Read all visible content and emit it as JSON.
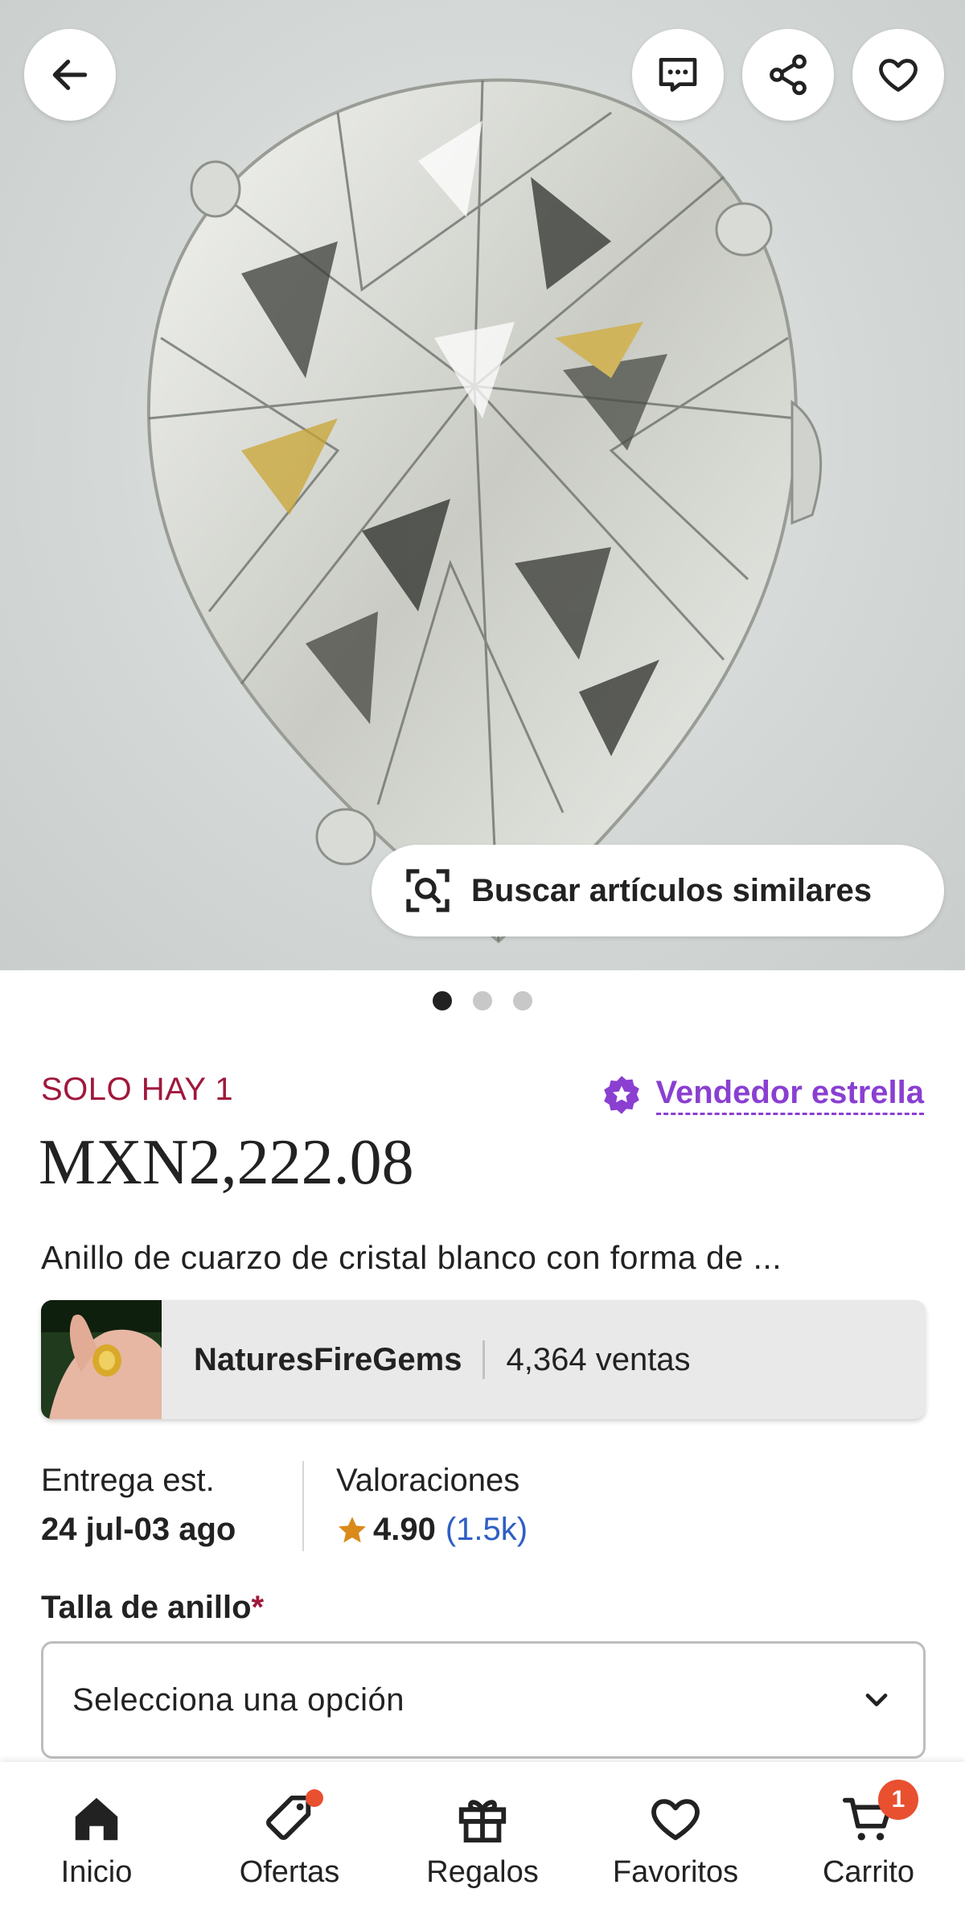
{
  "hero": {
    "similar_button_label": "Buscar artículos similares",
    "pages_total": 3,
    "page_active": 1
  },
  "product": {
    "stock_text": "SOLO HAY 1",
    "star_seller_label": "Vendedor estrella",
    "price": "MXN2,222.08",
    "title": "Anillo de cuarzo de cristal blanco con forma de ..."
  },
  "shop": {
    "name": "NaturesFireGems",
    "sales": "4,364 ventas"
  },
  "delivery": {
    "label": "Entrega est.",
    "dates": "24 jul-03 ago"
  },
  "ratings": {
    "label": "Valoraciones",
    "score": "4.90",
    "count": "(1.5k)"
  },
  "ring_size": {
    "label": "Talla de anillo",
    "required_mark": "*",
    "placeholder": "Selecciona una opción"
  },
  "nav": {
    "items": [
      {
        "label": "Inicio",
        "icon": "home-icon"
      },
      {
        "label": "Ofertas",
        "icon": "tag-icon"
      },
      {
        "label": "Regalos",
        "icon": "gift-icon"
      },
      {
        "label": "Favoritos",
        "icon": "heart-icon"
      },
      {
        "label": "Carrito",
        "icon": "cart-icon"
      }
    ],
    "cart_badge": "1"
  },
  "colors": {
    "stock": "#a0183c",
    "star_seller": "#8a3fd1",
    "rating_count": "#2f5ec4",
    "badge": "#e8502f"
  }
}
